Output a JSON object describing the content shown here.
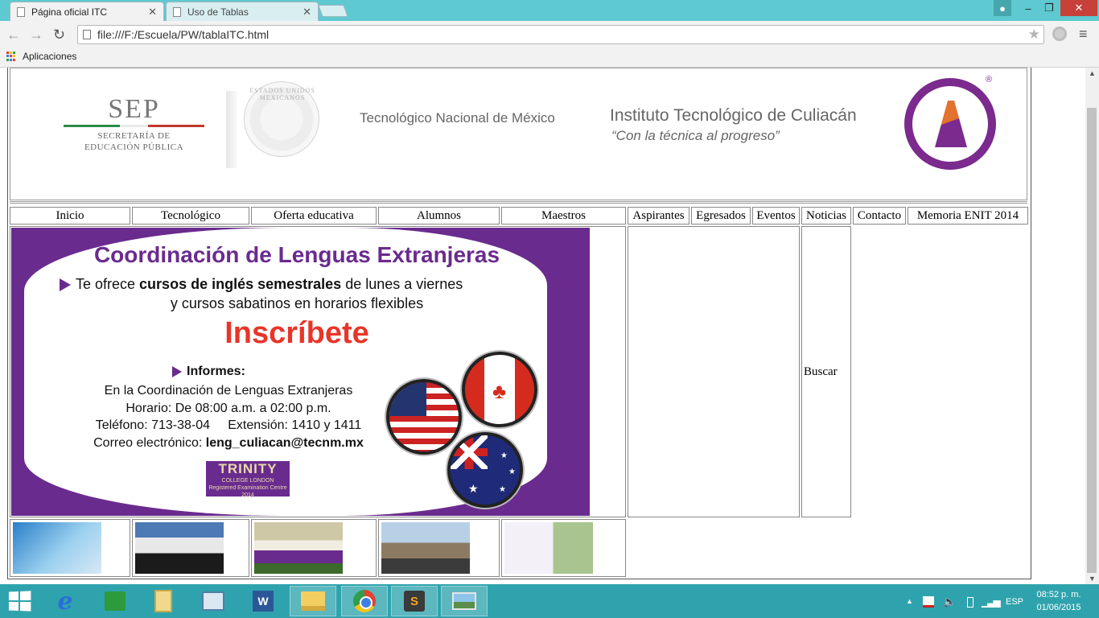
{
  "browser": {
    "tabs": [
      {
        "title": "Página oficial ITC",
        "active": true
      },
      {
        "title": "Uso de Tablas",
        "active": false
      }
    ],
    "window_controls": {
      "user": "",
      "minimize": "–",
      "maximize": "❐",
      "close": "✕"
    },
    "nav": {
      "back": "←",
      "forward": "→",
      "reload": "↻"
    },
    "url": "file:///F:/Escuela/PW/tablaITC.html",
    "bookmarks": {
      "apps_label": "Aplicaciones"
    }
  },
  "page": {
    "header": {
      "sep_big": "SEP",
      "sep_sub_1": "SECRETARÍA DE",
      "sep_sub_2": "EDUCACIÓN PÚBLICA",
      "seal_text": "ESTADOS UNIDOS MEXICANOS",
      "tecnm": "Tecnológico Nacional de México",
      "itc_title": "Instituto Tecnológico de Culiacán",
      "itc_slogan": "“Con la técnica al progreso”",
      "registered": "®"
    },
    "nav": [
      "Inicio",
      "Tecnológico",
      "Oferta educativa",
      "Alumnos",
      "Maestros",
      "Aspirantes",
      "Egresados",
      "Eventos",
      "Noticias",
      "Contacto",
      "Memoria ENIT 2014"
    ],
    "banner": {
      "title": "Coordinación de Lenguas Extranjeras",
      "line1_pre": "Te ofrece ",
      "line1_bold": "cursos de inglés semestrales",
      "line1_post": " de lunes a viernes",
      "line2": "y cursos sabatinos en horarios flexibles",
      "cta": "Inscríbete",
      "informes": "Informes:",
      "info_place": "En la Coordinación de Lenguas Extranjeras",
      "info_hours": "Horario: De 08:00 a.m. a 02:00 p.m.",
      "info_phone": "Teléfono: 713-38-04     Extensión: 1410 y 1411",
      "info_email_label": "Correo electrónico: ",
      "info_email": "leng_culiacan@tecnm.mx",
      "trinity_big": "TRINITY",
      "trinity_sub1": "COLLEGE LONDON",
      "trinity_sub2": "Registered Examination Centre 2014"
    },
    "search_label": "Buscar",
    "thumbnails": [
      "thumb-1",
      "thumb-2",
      "thumb-3",
      "thumb-4",
      "thumb-5"
    ]
  },
  "taskbar": {
    "language": "ESP",
    "time": "08:52 p. m.",
    "date": "01/06/2015",
    "apps": [
      "start-icon",
      "internet-explorer-icon",
      "store-icon",
      "documents-icon",
      "control-panel-icon",
      "word-icon",
      "file-explorer-icon",
      "chrome-icon",
      "sublime-text-icon",
      "photos-icon"
    ]
  },
  "colors": {
    "accent_teal": "#5ec9d0",
    "purple": "#6a2b8e",
    "red": "#e8352a",
    "taskbar": "#2fa3ad"
  }
}
